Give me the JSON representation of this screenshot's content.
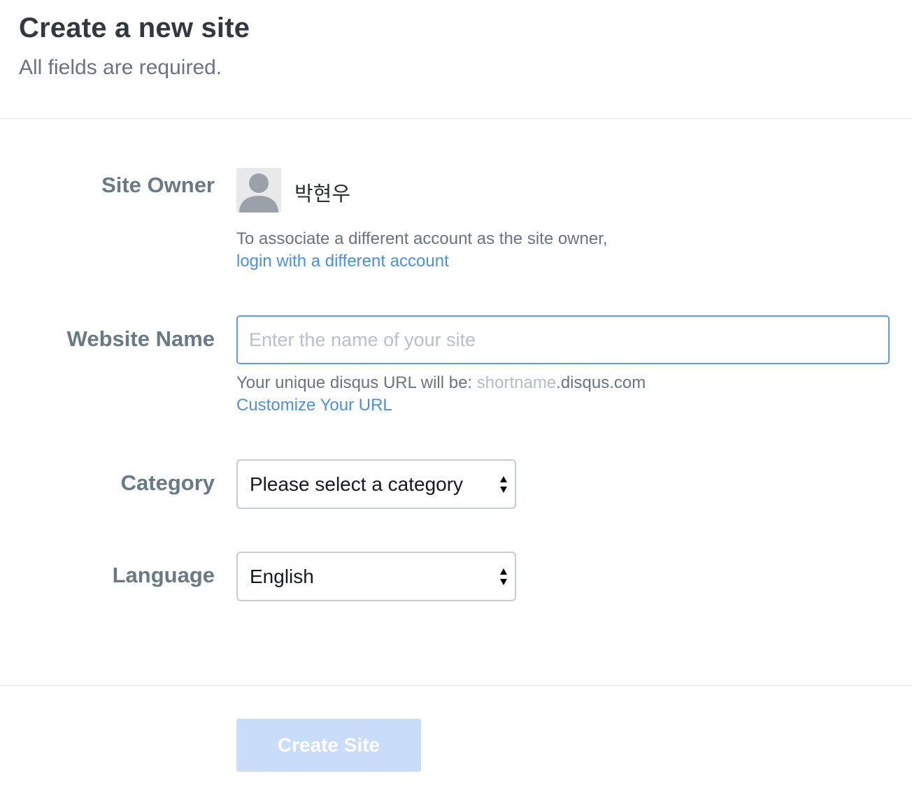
{
  "header": {
    "title": "Create a new site",
    "subtitle": "All fields are required."
  },
  "site_owner": {
    "label": "Site Owner",
    "avatar_icon": "user-silhouette-icon",
    "name": "박현우",
    "help_text": "To associate a different account as the site owner,",
    "login_link": "login with a different account"
  },
  "website_name": {
    "label": "Website Name",
    "value": "",
    "placeholder": "Enter the name of your site",
    "url_prefix": "Your unique disqus URL will be: ",
    "url_shortname": "shortname",
    "url_suffix": ".disqus.com",
    "customize_link": "Customize Your URL"
  },
  "category": {
    "label": "Category",
    "selected": "Please select a category",
    "arrow_icon": "select-arrows-icon"
  },
  "language": {
    "label": "Language",
    "selected": "English",
    "arrow_icon": "select-arrows-icon"
  },
  "footer": {
    "submit_label": "Create Site"
  },
  "colors": {
    "link": "#4a90e2",
    "input_focus_border": "#5b9be8",
    "button_disabled_bg": "#c9ddfb",
    "label": "#687a86"
  }
}
